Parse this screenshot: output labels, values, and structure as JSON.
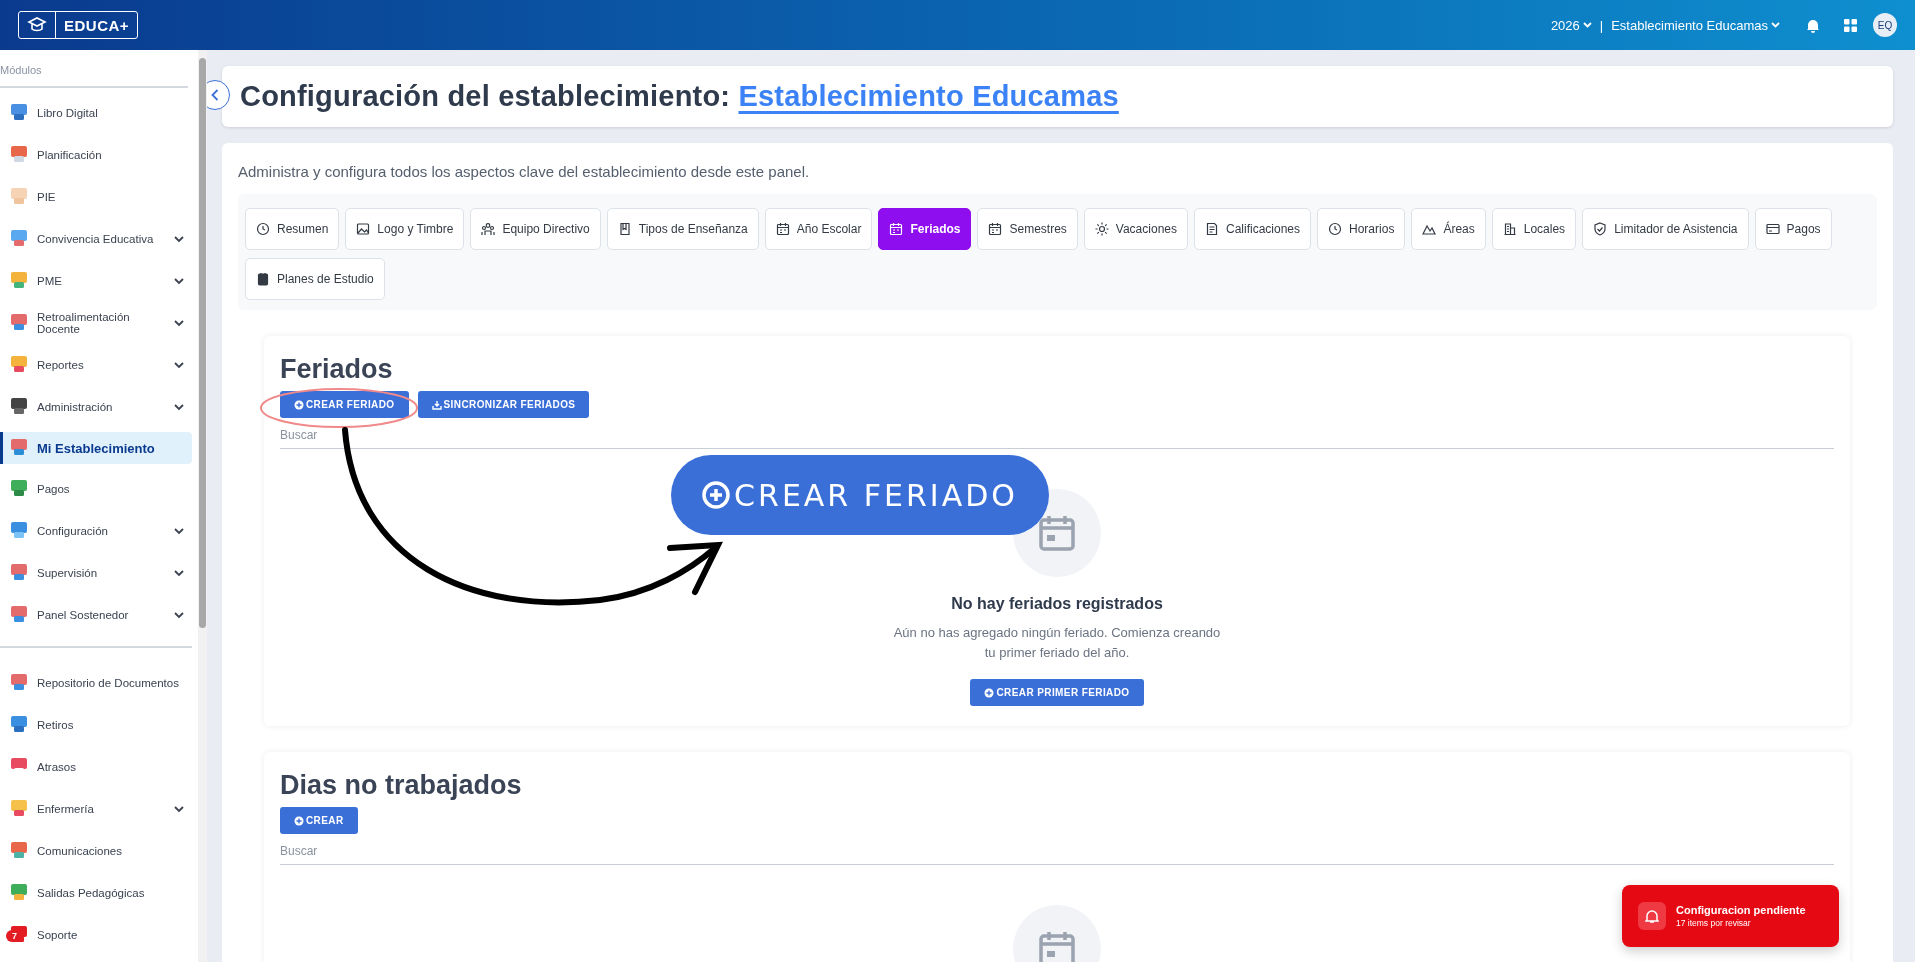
{
  "topbar": {
    "logo_text": "EDUCA+",
    "year": "2026",
    "separator": "|",
    "establishment": "Establecimiento Educamas",
    "avatar": "EQ"
  },
  "sidebar": {
    "heading": "Módulos",
    "sections": [
      {
        "items": [
          {
            "label": "Libro Digital",
            "kind": "link",
            "selected": false
          },
          {
            "label": "Planificación",
            "kind": "link",
            "selected": false
          },
          {
            "label": "PIE",
            "kind": "link",
            "selected": false
          },
          {
            "label": "Convivencia Educativa",
            "kind": "group",
            "selected": false
          },
          {
            "label": "PME",
            "kind": "group",
            "selected": false
          },
          {
            "label": "Retroalimentación Docente",
            "kind": "group",
            "selected": false
          },
          {
            "label": "Reportes",
            "kind": "group",
            "selected": false
          },
          {
            "label": "Administración",
            "kind": "group",
            "selected": false
          },
          {
            "label": "Mi Establecimiento",
            "kind": "link",
            "selected": true
          },
          {
            "label": "Pagos",
            "kind": "link",
            "selected": false
          },
          {
            "label": "Configuración",
            "kind": "group",
            "selected": false
          },
          {
            "label": "Supervisión",
            "kind": "group",
            "selected": false
          },
          {
            "label": "Panel Sostenedor",
            "kind": "group",
            "selected": false
          }
        ]
      },
      {
        "items": [
          {
            "label": "Repositorio de Documentos",
            "kind": "link",
            "selected": false
          },
          {
            "label": "Retiros",
            "kind": "link",
            "selected": false
          },
          {
            "label": "Atrasos",
            "kind": "link",
            "selected": false
          },
          {
            "label": "Enfermería",
            "kind": "group",
            "selected": false
          },
          {
            "label": "Comunicaciones",
            "kind": "link",
            "selected": false
          },
          {
            "label": "Salidas Pedagógicas",
            "kind": "link",
            "selected": false
          },
          {
            "label": "Soporte",
            "kind": "link",
            "selected": false,
            "badge": "7"
          }
        ]
      }
    ]
  },
  "title": {
    "text": "Configuración del establecimiento: ",
    "link": "Establecimiento Educamas"
  },
  "description": "Administra y configura todos los aspectos clave del establecimiento desde este panel.",
  "tabs": [
    {
      "label": "Resumen",
      "selected": false
    },
    {
      "label": "Logo y Timbre",
      "selected": false
    },
    {
      "label": "Equipo Directivo",
      "selected": false
    },
    {
      "label": "Tipos de Enseñanza",
      "selected": false
    },
    {
      "label": "Año Escolar",
      "selected": false
    },
    {
      "label": "Feriados",
      "selected": true
    },
    {
      "label": "Semestres",
      "selected": false
    },
    {
      "label": "Vacaciones",
      "selected": false
    },
    {
      "label": "Calificaciones",
      "selected": false
    },
    {
      "label": "Horarios",
      "selected": false
    },
    {
      "label": "Áreas",
      "selected": false
    },
    {
      "label": "Locales",
      "selected": false
    },
    {
      "label": "Limitador de Asistencia",
      "selected": false
    },
    {
      "label": "Pagos",
      "selected": false
    },
    {
      "label": "Planes de Estudio",
      "selected": false
    }
  ],
  "sections": [
    {
      "title": "Feriados",
      "buttons": [
        "CREAR FERIADO",
        "SINCRONIZAR FERIADOS"
      ],
      "search_placeholder": "Buscar",
      "empty": {
        "title": "No hay feriados registrados",
        "text": "Aún no has agregado ningún feriado. Comienza creando tu primer feriado del año.",
        "button": "CREAR PRIMER FERIADO"
      }
    },
    {
      "title": "Dias no trabajados",
      "buttons": [
        "CREAR"
      ],
      "search_placeholder": "Buscar"
    }
  ],
  "annotation": {
    "callout": "CREAR FERIADO"
  },
  "toast": {
    "title": "Configuracion pendiente",
    "subtitle": "17 items por revisar"
  }
}
